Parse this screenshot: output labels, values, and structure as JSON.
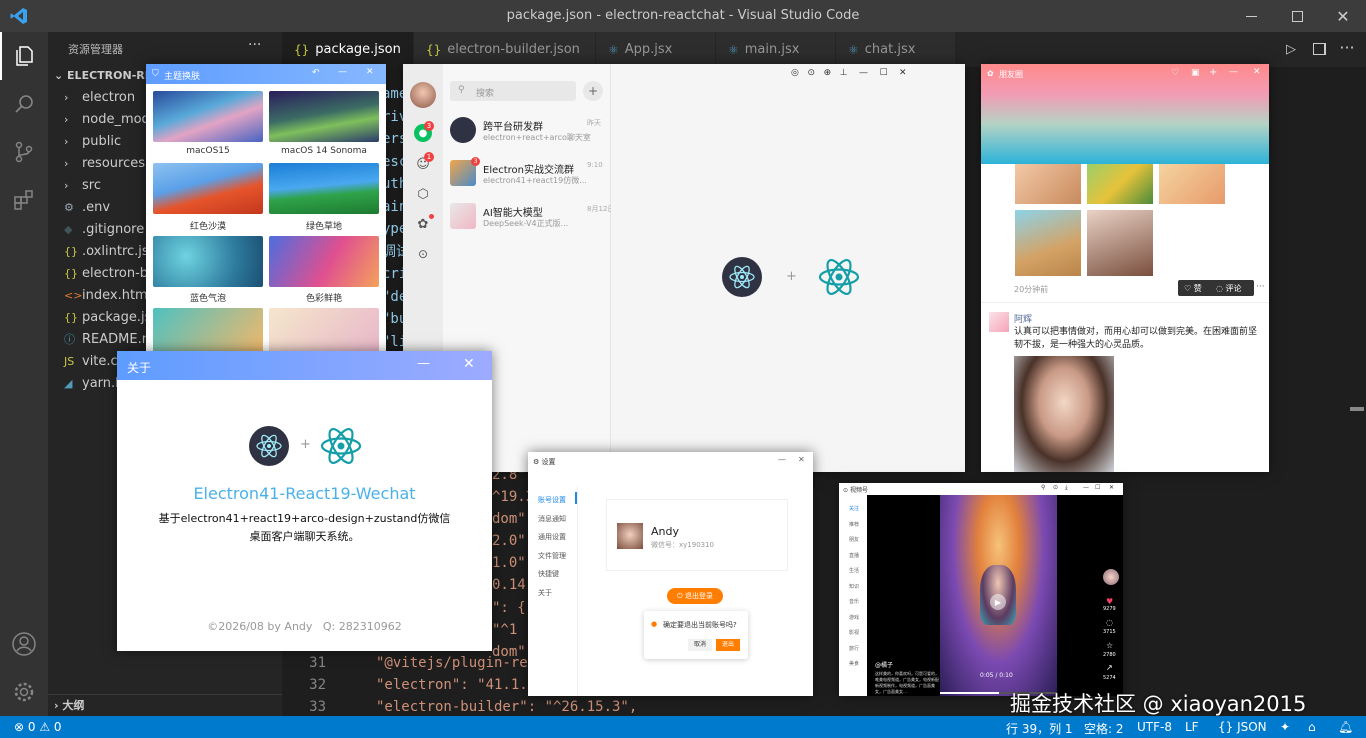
{
  "window": {
    "title": "package.json - electron-reactchat - Visual Studio Code"
  },
  "sidebar": {
    "header": "资源管理器",
    "project": "ELECTRON-REA",
    "items": [
      {
        "label": "electron",
        "icon": "chevron-right"
      },
      {
        "label": "node_modu",
        "icon": "chevron-right"
      },
      {
        "label": "public",
        "icon": "chevron-right"
      },
      {
        "label": "resources",
        "icon": "chevron-right"
      },
      {
        "label": "src",
        "icon": "chevron-right"
      },
      {
        "label": ".env",
        "icon": "gear"
      },
      {
        "label": ".gitignore",
        "icon": "git"
      },
      {
        "label": ".oxlintrc.jso",
        "icon": "json"
      },
      {
        "label": "electron-bu",
        "icon": "json"
      },
      {
        "label": "index.html",
        "icon": "html"
      },
      {
        "label": "package.jso",
        "icon": "json"
      },
      {
        "label": "README.m",
        "icon": "info"
      },
      {
        "label": "vite.co",
        "icon": "js"
      },
      {
        "label": "yarn.lo",
        "icon": "yarn"
      }
    ],
    "outline": "大纲"
  },
  "tabs": [
    {
      "label": "package.json",
      "icon": "{}"
    },
    {
      "label": "electron-builder.json",
      "icon": "{}"
    },
    {
      "label": "App.jsx",
      "icon": "react"
    },
    {
      "label": "main.jsx",
      "icon": "react"
    },
    {
      "label": "chat.jsx",
      "icon": "react"
    }
  ],
  "editor": {
    "lines": [
      {
        "n": "31",
        "text": "\"@vitejs/plugin-rea"
      },
      {
        "n": "32",
        "text": "\"electron\": \"41.1.0"
      },
      {
        "n": "33",
        "text": "\"electron-builder\": \"^26.15.3\","
      }
    ],
    "fragments": [
      "ame",
      "riv",
      "ers",
      "esc",
      "uth",
      "ain",
      "ype",
      "调试",
      "cri",
      "\"de",
      "\"bu",
      "\"li",
      "\"pr",
      "rel"
    ],
    "fragments2": [
      "2.8\",",
      "^19.2",
      "dom\":",
      "2.0\",",
      "1.0\"",
      "0.14",
      "\": {",
      "\"^1",
      "dom\":"
    ]
  },
  "status": {
    "errors": "⊗ 0 ⚠ 0",
    "position": "行 39，列 1",
    "spaces": "空格: 2",
    "encoding": "UTF-8",
    "eol": "LF",
    "language": "{} JSON",
    "watermark": "掘金技术社区 @ xiaoyan2015"
  },
  "theme_window": {
    "title": "主题换肤",
    "tiles": [
      "macOS15",
      "macOS 14 Sonoma",
      "红色沙漠",
      "绿色草地",
      "蓝色气泡",
      "色彩鲜艳"
    ]
  },
  "about_window": {
    "title": "关于",
    "app_name": "Electron41-React19-Wechat",
    "desc1": "基于electron41+react19+arco-design+zustand仿微信",
    "desc2": "桌面客户端聊天系统。",
    "footer": "©2026/08 by Andy   Q: 282310962",
    "plus": "+"
  },
  "chat_window": {
    "search": "搜索",
    "plus": "+",
    "badge1": "3",
    "badge2": "1",
    "chats": [
      {
        "name": "跨平台研发群",
        "msg": "electron+react+arco聊天室",
        "time": "昨天"
      },
      {
        "name": "Electron实战交流群",
        "msg": "electron41+react19仿微...",
        "time": "9:10",
        "badge": "3"
      },
      {
        "name": "AI智能大模型",
        "msg": "DeepSeek-V4正式版...",
        "time": "8月12日"
      }
    ],
    "plus_center": "+"
  },
  "moments_window": {
    "title": "朋友圈",
    "time": "20分钟前",
    "like": "赞",
    "comment": "评论",
    "user": "阿辉",
    "text": "认真可以把事情做对，而用心却可以做到完美。在困难面前坚韧不拔，是一种强大的心灵品质。"
  },
  "settings_window": {
    "title": "设置",
    "menu": [
      "账号设置",
      "消息通知",
      "通用设置",
      "文件管理",
      "快捷键",
      "关于"
    ],
    "user": "Andy",
    "wechat_id": "微信号：xy190310",
    "logout": "退出登录",
    "confirm": "确定要退出当前账号吗?",
    "cancel": "取消",
    "ok": "退出"
  },
  "video_window": {
    "title": "视频号",
    "tabs": [
      "关注",
      "推荐",
      "朋友",
      "直播",
      "生活",
      "知识",
      "音乐",
      "游戏",
      "影视",
      "旅行",
      "美食"
    ],
    "author": "@橘子",
    "caption": "这样美的，你喜欢吗，可是可爱的，唯美电视频道，广告美女，电视新配新视频制作，电视频道，广告面美女，广告面美女…",
    "counts": [
      "9279",
      "3715",
      "2780",
      "5274"
    ],
    "time": "0:05 / 0:10"
  },
  "colors": {
    "accent": "#007acc",
    "wechat_green": "#07c160",
    "electron": "#47848f",
    "react": "#139ea8"
  }
}
